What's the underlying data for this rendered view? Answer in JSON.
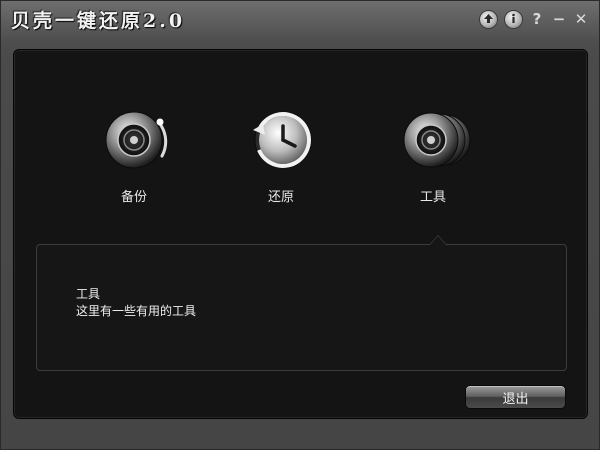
{
  "window": {
    "title": "贝壳一键还原2.0"
  },
  "titlebar_buttons": {
    "update_icon": "up-arrow-icon",
    "info_icon": "info-icon",
    "help_label": "?",
    "minimize_label": "−",
    "close_label": "✕"
  },
  "tools": [
    {
      "label": "备份",
      "icon": "disc-backup-icon"
    },
    {
      "label": "还原",
      "icon": "clock-restore-icon"
    },
    {
      "label": "工具",
      "icon": "discs-tools-icon"
    }
  ],
  "info": {
    "title": "工具",
    "description": "这里有一些有用的工具"
  },
  "footer": {
    "exit_label": "退出"
  }
}
